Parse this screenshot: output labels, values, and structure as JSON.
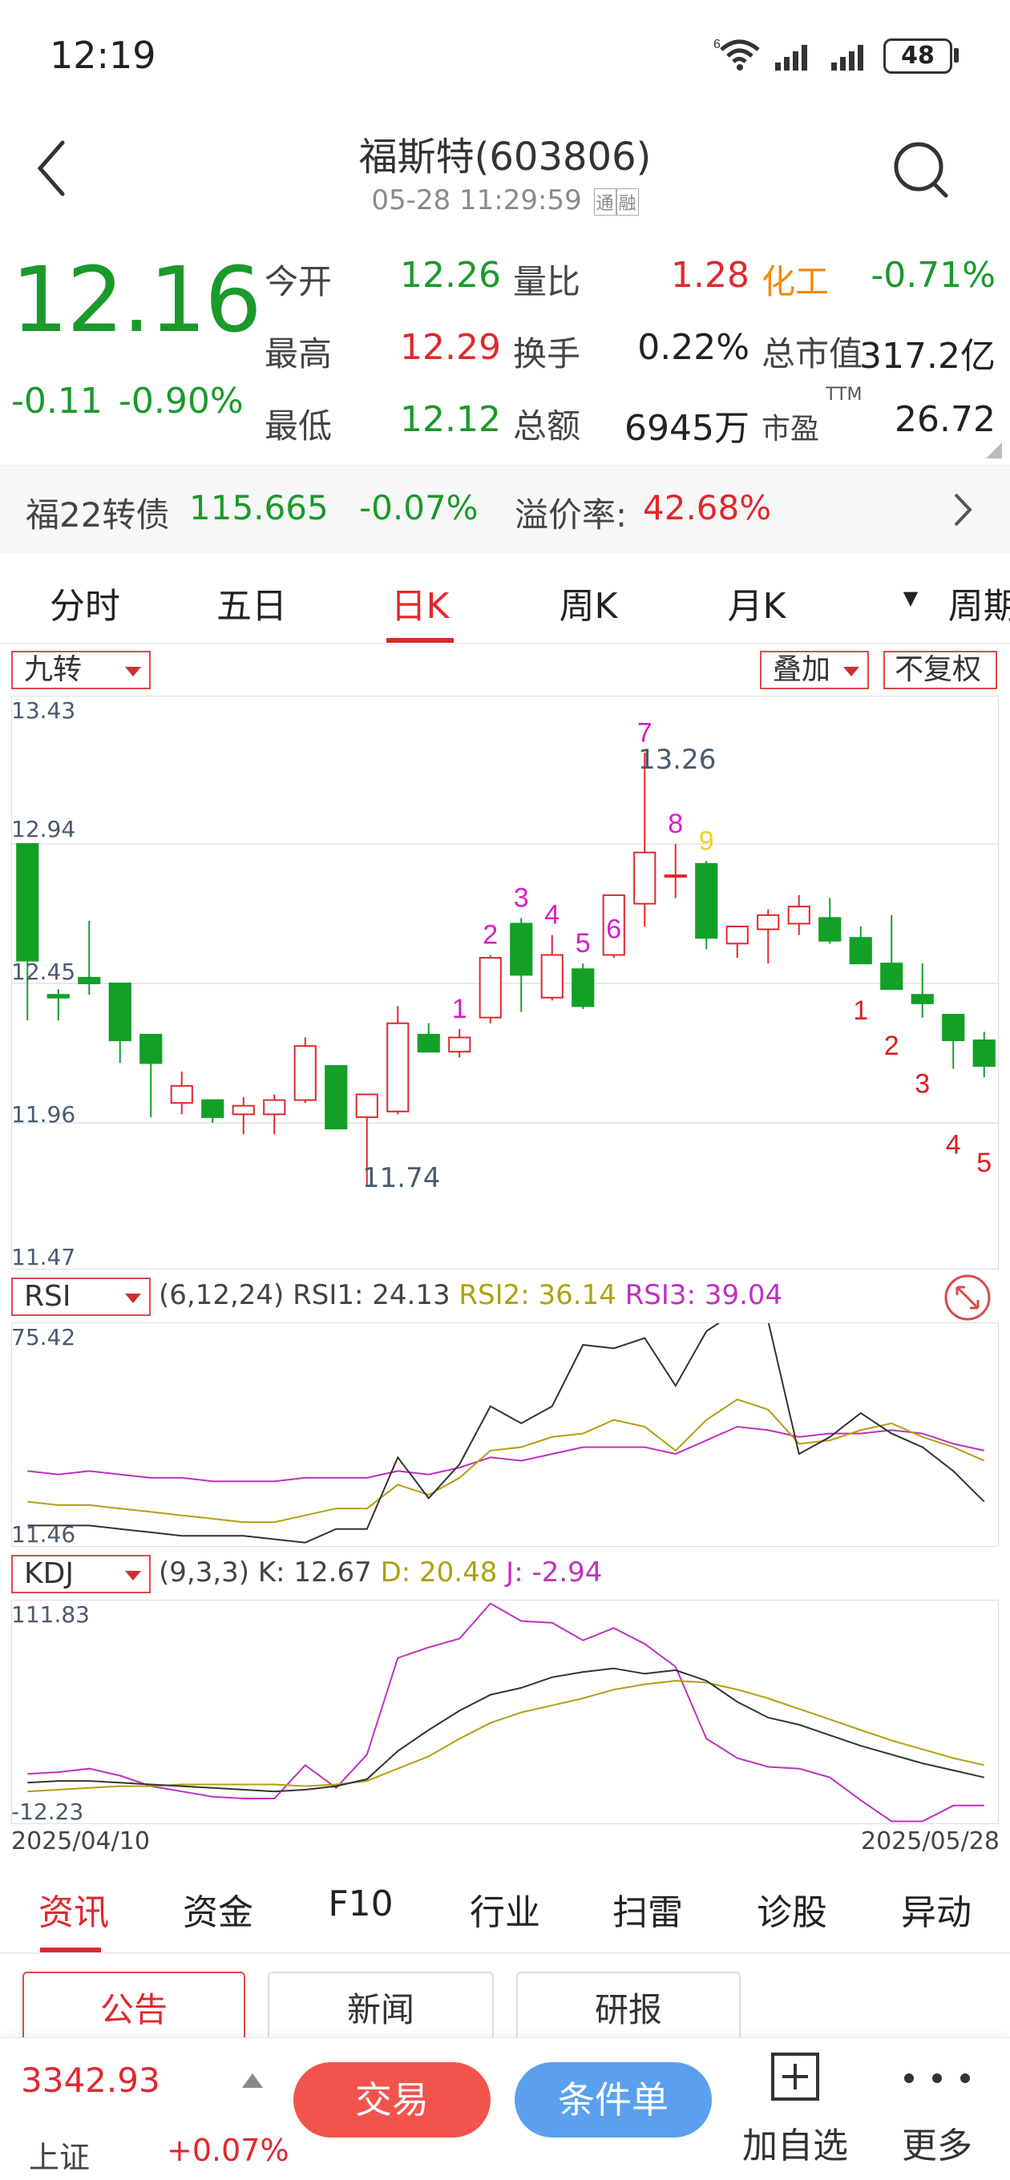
{
  "status_bar": {
    "time": "12:19",
    "battery": "48"
  },
  "header": {
    "title": "福斯特(603806)",
    "datetime": "05-28 11:29:59",
    "tags": [
      "通",
      "融"
    ]
  },
  "quote": {
    "price": "12.16",
    "change": "-0.11",
    "change_pct": "-0.90%",
    "open_label": "今开",
    "open": "12.26",
    "high_label": "最高",
    "high": "12.29",
    "low_label": "最低",
    "low": "12.12",
    "vol_ratio_label": "量比",
    "vol_ratio": "1.28",
    "turnover_label": "换手",
    "turnover": "0.22%",
    "amount_label": "总额",
    "amount": "6945万",
    "sector_label": "化工",
    "sector_change": "-0.71%",
    "mktcap_label": "总市值",
    "mktcap": "317.2亿",
    "pe_label": "市盈",
    "pe_sup": "TTM",
    "pe": "26.72"
  },
  "bond": {
    "name": "福22转债",
    "price": "115.665",
    "change_pct": "-0.07%",
    "premium_label": "溢价率:",
    "premium": "42.68%"
  },
  "period_tabs": [
    "分时",
    "五日",
    "日K",
    "周K",
    "月K",
    "周期"
  ],
  "active_period": "日K",
  "kline": {
    "indicator_select": "九转",
    "overlay_btn": "叠加",
    "adjust_btn": "不复权",
    "axis_labels": [
      "13.43",
      "12.94",
      "12.45",
      "11.96",
      "11.47"
    ],
    "high_mark": "13.26",
    "low_mark": "11.74",
    "ylim": [
      11.47,
      13.43
    ],
    "candles": [
      {
        "o": 12.94,
        "h": 12.94,
        "c": 12.53,
        "l": 12.32
      },
      {
        "o": 12.41,
        "h": 12.43,
        "c": 12.4,
        "l": 12.32
      },
      {
        "o": 12.47,
        "h": 12.67,
        "c": 12.45,
        "l": 12.41
      },
      {
        "o": 12.45,
        "h": 12.45,
        "c": 12.25,
        "l": 12.17
      },
      {
        "o": 12.27,
        "h": 12.27,
        "c": 12.17,
        "l": 11.98
      },
      {
        "o": 12.03,
        "h": 12.14,
        "c": 12.09,
        "l": 11.99
      },
      {
        "o": 12.04,
        "h": 12.04,
        "c": 11.98,
        "l": 11.96
      },
      {
        "o": 11.99,
        "h": 12.05,
        "c": 12.02,
        "l": 11.92
      },
      {
        "o": 11.99,
        "h": 12.06,
        "c": 12.04,
        "l": 11.92
      },
      {
        "o": 12.04,
        "h": 12.26,
        "c": 12.23,
        "l": 12.03
      },
      {
        "o": 12.16,
        "h": 12.16,
        "c": 11.94,
        "l": 11.94
      },
      {
        "o": 11.98,
        "h": 12.04,
        "c": 12.06,
        "l": 11.74
      },
      {
        "o": 12.0,
        "h": 12.37,
        "c": 12.31,
        "l": 11.99
      },
      {
        "o": 12.27,
        "h": 12.31,
        "c": 12.21,
        "l": 12.21
      },
      {
        "o": 12.21,
        "h": 12.29,
        "c": 12.26,
        "l": 12.19
      },
      {
        "o": 12.33,
        "h": 12.55,
        "c": 12.54,
        "l": 12.31
      },
      {
        "o": 12.66,
        "h": 12.68,
        "c": 12.48,
        "l": 12.35
      },
      {
        "o": 12.4,
        "h": 12.62,
        "c": 12.55,
        "l": 12.39
      },
      {
        "o": 12.5,
        "h": 12.52,
        "c": 12.37,
        "l": 12.36
      },
      {
        "o": 12.55,
        "h": 12.57,
        "c": 12.76,
        "l": 12.54
      },
      {
        "o": 12.73,
        "h": 13.26,
        "c": 12.91,
        "l": 12.65
      },
      {
        "o": 12.83,
        "h": 12.94,
        "c": 12.83,
        "l": 12.75
      },
      {
        "o": 12.87,
        "h": 12.88,
        "c": 12.61,
        "l": 12.57
      },
      {
        "o": 12.59,
        "h": 12.63,
        "c": 12.65,
        "l": 12.54
      },
      {
        "o": 12.64,
        "h": 12.71,
        "c": 12.69,
        "l": 12.52
      },
      {
        "o": 12.66,
        "h": 12.76,
        "c": 12.72,
        "l": 12.62
      },
      {
        "o": 12.68,
        "h": 12.75,
        "c": 12.6,
        "l": 12.59
      },
      {
        "o": 12.61,
        "h": 12.65,
        "c": 12.52,
        "l": 12.52
      },
      {
        "o": 12.52,
        "h": 12.69,
        "c": 12.43,
        "l": 12.43
      },
      {
        "o": 12.41,
        "h": 12.52,
        "c": 12.38,
        "l": 12.33
      },
      {
        "o": 12.34,
        "h": 12.34,
        "c": 12.25,
        "l": 12.15
      },
      {
        "o": 12.25,
        "h": 12.28,
        "c": 12.16,
        "l": 12.12
      }
    ],
    "nine_turn_up": [
      {
        "i": 14,
        "t": "1"
      },
      {
        "i": 15,
        "t": "2"
      },
      {
        "i": 16,
        "t": "3"
      },
      {
        "i": 17,
        "t": "4"
      },
      {
        "i": 18,
        "t": "5"
      },
      {
        "i": 19,
        "t": "6"
      },
      {
        "i": 20,
        "t": "7"
      },
      {
        "i": 21,
        "t": "8"
      },
      {
        "i": 22,
        "t": "9"
      }
    ],
    "nine_turn_down": [
      {
        "i": 27,
        "t": "1"
      },
      {
        "i": 28,
        "t": "2"
      },
      {
        "i": 29,
        "t": "3"
      },
      {
        "i": 30,
        "t": "4"
      },
      {
        "i": 31,
        "t": "5"
      }
    ],
    "colors": {
      "up": "#e0282e",
      "down": "#13a027",
      "nine_up": "#d81ec8",
      "nine_nine": "#f0d020",
      "nine_down": "#d82020"
    }
  },
  "rsi": {
    "select": "RSI",
    "params": "(6,12,24)",
    "rsi1": "RSI1: 24.13",
    "rsi2": "RSI2: 36.14",
    "rsi3": "RSI3: 39.04",
    "axis_top": "75.42",
    "axis_bottom": "11.46",
    "ylim": [
      11.46,
      75.42
    ],
    "series": {
      "rsi1": [
        17,
        17,
        17,
        16,
        15,
        14,
        14,
        14,
        13,
        12,
        16,
        16,
        37,
        25,
        35,
        52,
        47,
        52,
        70,
        69,
        72,
        58,
        74,
        80,
        77,
        38,
        43,
        50,
        44,
        40,
        33,
        24
      ],
      "rsi2": [
        24,
        23,
        23,
        22,
        21,
        20,
        19,
        18,
        18,
        20,
        22,
        22,
        29,
        26,
        31,
        39,
        40,
        43,
        44,
        48,
        46,
        39,
        48,
        54,
        51,
        41,
        42,
        45,
        47,
        43,
        40,
        36
      ],
      "rsi3": [
        33,
        32,
        33,
        32,
        31,
        31,
        30,
        30,
        30,
        31,
        31,
        31,
        33,
        32,
        34,
        37,
        36,
        38,
        40,
        40,
        40,
        38,
        42,
        46,
        45,
        43,
        44,
        44,
        45,
        44,
        41,
        39
      ]
    },
    "colors": {
      "rsi1": "#333333",
      "rsi2": "#b0a010",
      "rsi3": "#c030c0"
    }
  },
  "kdj": {
    "select": "KDJ",
    "params": "(9,3,3)",
    "k": "K: 12.67",
    "d": "D: 20.48",
    "j": "J: -2.94",
    "axis_top": "111.83",
    "axis_bottom": "-12.23",
    "ylim": [
      -12.23,
      111.83
    ],
    "series": {
      "k": [
        10,
        11,
        11,
        10,
        9,
        8,
        7,
        6,
        5,
        6,
        8,
        12,
        28,
        40,
        51,
        60,
        64,
        70,
        73,
        75,
        72,
        74,
        68,
        56,
        47,
        43,
        37,
        31,
        26,
        21,
        17,
        13
      ],
      "d": [
        5,
        6,
        7,
        8,
        8,
        9,
        9,
        9,
        9,
        8,
        9,
        11,
        18,
        25,
        35,
        44,
        50,
        54,
        58,
        63,
        66,
        68,
        67,
        63,
        58,
        52,
        46,
        40,
        34,
        29,
        24,
        20
      ],
      "j": [
        15,
        16,
        18,
        14,
        8,
        5,
        2,
        1,
        1,
        20,
        7,
        26,
        81,
        87,
        92,
        112,
        102,
        101,
        91,
        98,
        89,
        76,
        35,
        24,
        19,
        18,
        13,
        0,
        -12,
        -12,
        -3,
        -3
      ]
    },
    "colors": {
      "k": "#333333",
      "d": "#b0a010",
      "j": "#c030c0"
    }
  },
  "date_range": {
    "start": "2025/04/10",
    "end": "2025/05/28"
  },
  "info_tabs": [
    "资讯",
    "资金",
    "F10",
    "行业",
    "扫雷",
    "诊股",
    "异动"
  ],
  "active_info_tab": "资讯",
  "sub_tabs": [
    "公告",
    "新闻",
    "研报"
  ],
  "active_sub_tab": "公告",
  "footer": {
    "index_value": "3342.93",
    "index_name": "上证",
    "index_change": "+0.07%",
    "trade_btn": "交易",
    "condition_btn": "条件单",
    "add_watch": "加自选",
    "more": "更多"
  }
}
